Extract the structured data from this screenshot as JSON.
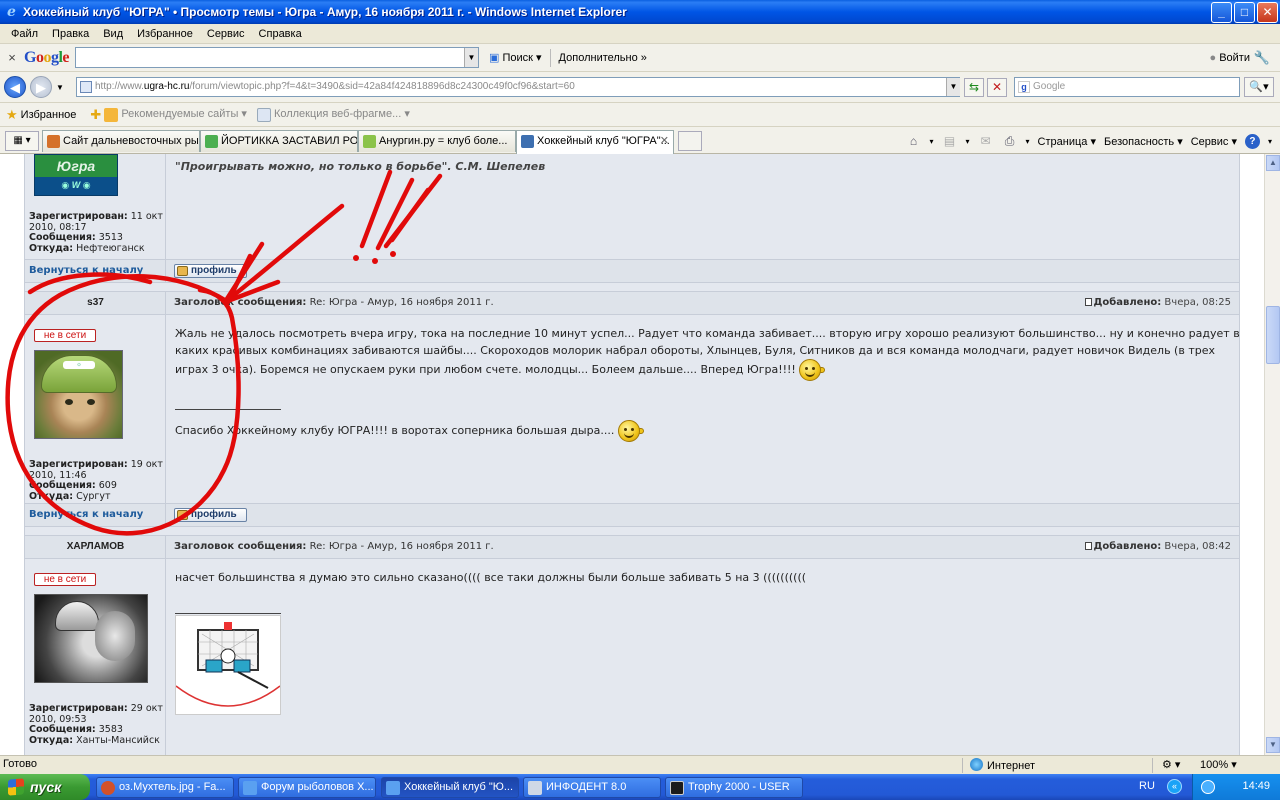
{
  "window": {
    "title": "Хоккейный клуб \"ЮГРА\" • Просмотр темы - Югра - Амур, 16 ноября 2011 г. - Windows Internet Explorer",
    "min": "_",
    "max": "□",
    "close": "✕"
  },
  "menu": [
    "Файл",
    "Правка",
    "Вид",
    "Избранное",
    "Сервис",
    "Справка"
  ],
  "google_toolbar": {
    "close": "×",
    "search_btn": "Поиск",
    "more": "Дополнительно »",
    "login": "Войти",
    "wrench": "🔧"
  },
  "address": {
    "prefix": "http://www.",
    "domain": "ugra-hc.ru",
    "path": "/forum/viewtopic.php?f=4&t=3490&sid=42a84f424818896d8c24300c49f0cf96&start=60",
    "search_placeholder": "Google"
  },
  "favorites": {
    "label": "Избранное",
    "recommended": "Рекомендуемые сайты ▾",
    "collection": "Коллекция веб-фрагме... ▾"
  },
  "tabs": [
    {
      "title": "Сайт дальневосточных ры...",
      "color": "#d5712a"
    },
    {
      "title": "ЙОРТИККА ЗАСТАВИЛ РОС...",
      "color": "#4caf50"
    },
    {
      "title": "Анургин.ру = клуб боле...",
      "color": "#8bc34a"
    },
    {
      "title": "Хоккейный клуб \"ЮГРА\"...",
      "color": "#3d6fb0"
    }
  ],
  "commands": {
    "page": "Страница ▾",
    "security": "Безопасность ▾",
    "service": "Сервис ▾"
  },
  "posts": [
    {
      "quote": "\"Проигрывать можно, но только в борьбе\". С.М. Шепелев",
      "info": {
        "registered_label": "Зарегистрирован:",
        "registered": "11 окт 2010, 08:17",
        "messages_label": "Сообщения:",
        "messages": "3513",
        "from_label": "Откуда:",
        "from": "Нефтеюганск"
      },
      "back": "Вернуться к началу",
      "profile": "профиль"
    },
    {
      "user": "s37",
      "subject_label": "Заголовок сообщения:",
      "subject": "Re: Югра - Амур, 16 ноября 2011 г.",
      "added_label": "Добавлено:",
      "added": "Вчера, 08:25",
      "status": "не в сети",
      "text": "Жаль не удалось посмотреть вчера игру, тока на последние 10 минут успел... Радует что команда забивает.... вторую игру хорошо реализуют большинство... ну и конечно радует в каких красивых комбинациях забиваются шайбы.... Скороходов молорик набрал обороты, Хлынцев, Буля, Ситников да и вся команда молодчаги, радует новичок Видель (в трех играх 3 очка). Боремся не опускаем руки при любом счете. молодцы... Болеем дальше.... Вперед Югра!!!!",
      "signature": "Спасибо Хоккейному клубу ЮГРА!!!! в воротах соперника большая дыра....",
      "info": {
        "registered_label": "Зарегистрирован:",
        "registered": "19 окт 2010, 11:46",
        "messages_label": "Сообщения:",
        "messages": "609",
        "from_label": "Откуда:",
        "from": "Сургут"
      },
      "back": "Вернуться к началу",
      "profile": "профиль"
    },
    {
      "user": "ХАРЛАМОВ",
      "subject_label": "Заголовок сообщения:",
      "subject": "Re: Югра - Амур, 16 ноября 2011 г.",
      "added_label": "Добавлено:",
      "added": "Вчера, 08:42",
      "status": "не в сети",
      "text": "насчет большинства я думаю это сильно сказано(((( все таки должны были больше забивать 5 на 3 ((((((((((",
      "info": {
        "registered_label": "Зарегистрирован:",
        "registered": "29 окт 2010, 09:53",
        "messages_label": "Сообщения:",
        "messages": "3583",
        "from_label": "Откуда:",
        "from": "Ханты-Мансийск"
      }
    }
  ],
  "status": {
    "ready": "Готово",
    "zone": "Интернет",
    "zoom": "100% ▾"
  },
  "taskbar": {
    "start": "пуск",
    "items": [
      {
        "title": "оз.Мухтель.jpg - Fa...",
        "color": "#d2512a"
      },
      {
        "title": "Форум рыболовов Х...",
        "color": "#2f6de0"
      },
      {
        "title": "Хоккейный клуб \"Ю...",
        "color": "#2f6de0"
      },
      {
        "title": "ИНФОДЕНТ 8.0",
        "color": "#cfd8e6"
      },
      {
        "title": "Trophy 2000 - USER",
        "color": "#1b1b1b"
      }
    ],
    "lang": "RU",
    "clock": "14:49"
  }
}
